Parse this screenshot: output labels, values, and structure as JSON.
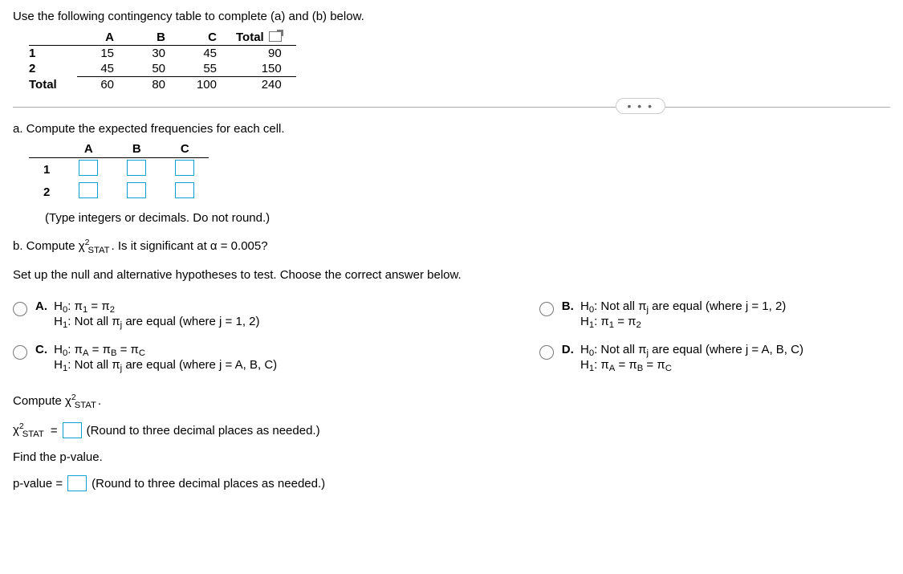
{
  "intro": "Use the following contingency table to complete (a) and (b) below.",
  "contingency": {
    "headers": [
      "A",
      "B",
      "C",
      "Total"
    ],
    "rows": {
      "r1_label": "1",
      "r1": [
        "15",
        "30",
        "45",
        "90"
      ],
      "r2_label": "2",
      "r2": [
        "45",
        "50",
        "55",
        "150"
      ],
      "total_label": "Total",
      "total": [
        "60",
        "80",
        "100",
        "240"
      ]
    }
  },
  "dots": "…",
  "part_a": {
    "prompt": "a. Compute the expected frequencies for each cell.",
    "headers": [
      "A",
      "B",
      "C"
    ],
    "row1_label": "1",
    "row2_label": "2",
    "hint": "(Type integers or decimals. Do not round.)"
  },
  "part_b": {
    "prompt_prefix": "b. Compute ",
    "prompt_suffix": ". Is it significant at α = 0.005?",
    "chi_label": "χ",
    "chi_sq_sup": "2",
    "chi_sub": "STAT",
    "setup": "Set up the null and alternative hypotheses to test. Choose the correct answer below."
  },
  "choices": {
    "A": {
      "letter": "A.",
      "h0": "H₀: π₁ = π₂",
      "h1": "H₁: Not all πⱼ are equal (where j = 1, 2)"
    },
    "B": {
      "letter": "B.",
      "h0": "H₀: Not all πⱼ are equal (where j = 1, 2)",
      "h1": "H₁: π₁ = π₂"
    },
    "C": {
      "letter": "C.",
      "h0": "H₀: π_A = π_B = π_C",
      "h1": "H₁: Not all πⱼ are equal (where j = A, B, C)"
    },
    "D": {
      "letter": "D.",
      "h0": "H₀: Not all πⱼ are equal (where j = A, B, C)",
      "h1": "H₁: π_A = π_B = π_C"
    }
  },
  "compute": {
    "label_prefix": "Compute ",
    "label_suffix": ".",
    "eq": " = ",
    "hint_stat": "(Round to three decimal places as needed.)",
    "find_p": "Find the p-value.",
    "pvalue_label": "p-value = ",
    "hint_p": "(Round to three decimal places as needed.)"
  }
}
